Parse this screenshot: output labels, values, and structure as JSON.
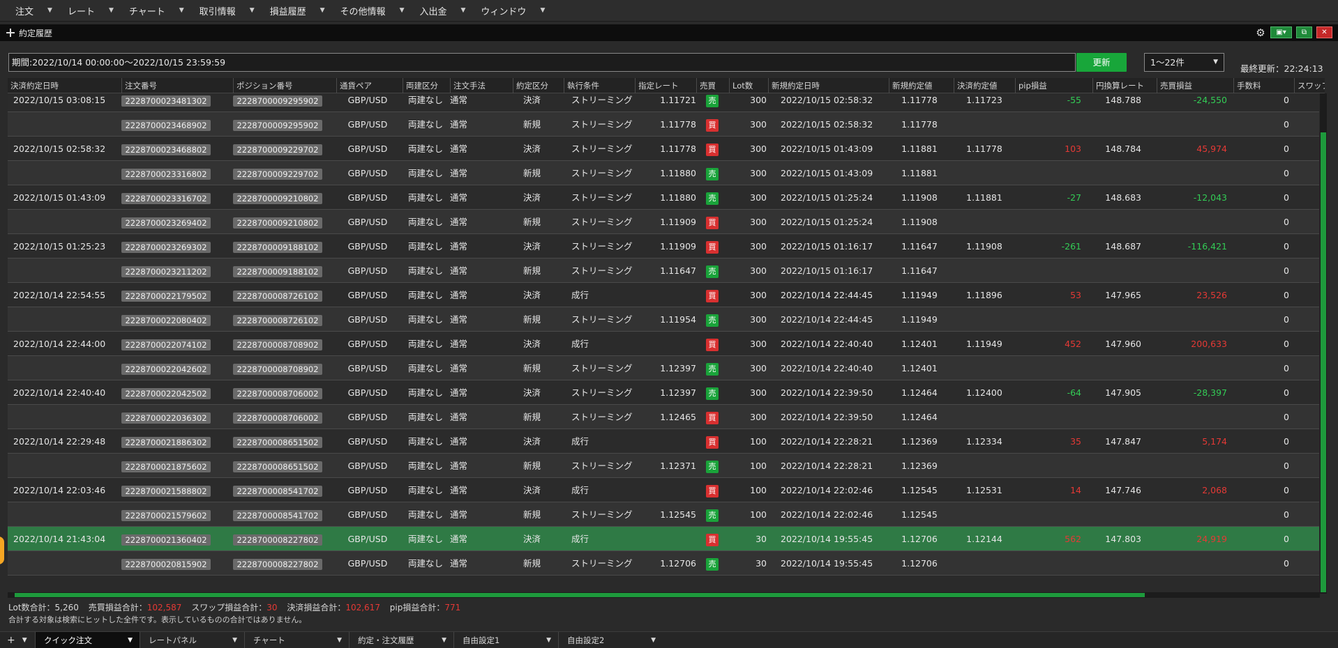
{
  "menu": [
    {
      "label": "注文"
    },
    {
      "label": "レート"
    },
    {
      "label": "チャート"
    },
    {
      "label": "取引情報"
    },
    {
      "label": "損益履歴"
    },
    {
      "label": "その他情報"
    },
    {
      "label": "入出金"
    },
    {
      "label": "ウィンドウ"
    }
  ],
  "window": {
    "title": "約定履歴"
  },
  "filter": {
    "period": "期間:2022/10/14 00:00:00～2022/10/15 23:59:59",
    "refresh_label": "更新",
    "page_range": "1～22件",
    "last_update": "最終更新：22:24:13"
  },
  "columns": [
    "決済約定日時",
    "注文番号",
    "ポジション番号",
    "通貨ペア",
    "両建区分",
    "注文手法",
    "約定区分",
    "執行条件",
    "指定レート",
    "売買",
    "Lot数",
    "新規約定日時",
    "新規約定値",
    "決済約定値",
    "pip損益",
    "円換算レート",
    "売買損益",
    "手数料",
    "スワップ損"
  ],
  "rows": [
    {
      "settle_time": "2022/10/15 03:08:15",
      "order_no": "2228700023481302",
      "pos_no": "2228700009295902",
      "pair": "GBP/USD",
      "hedge": "両建なし",
      "method": "通常",
      "kind": "決済",
      "cond": "ストリーミング",
      "rate": "1.11721",
      "side": "売",
      "lot": "300",
      "open_time": "2022/10/15 02:58:32",
      "open_price": "1.11778",
      "close_price": "1.11723",
      "pip": "-55",
      "jpy_rate": "148.788",
      "pl": "-24,550",
      "fee": "0"
    },
    {
      "settle_time": "",
      "order_no": "2228700023468902",
      "pos_no": "2228700009295902",
      "pair": "GBP/USD",
      "hedge": "両建なし",
      "method": "通常",
      "kind": "新規",
      "cond": "ストリーミング",
      "rate": "1.11778",
      "side": "買",
      "lot": "300",
      "open_time": "2022/10/15 02:58:32",
      "open_price": "1.11778",
      "close_price": "",
      "pip": "",
      "jpy_rate": "",
      "pl": "",
      "fee": "0"
    },
    {
      "settle_time": "2022/10/15 02:58:32",
      "order_no": "2228700023468802",
      "pos_no": "2228700009229702",
      "pair": "GBP/USD",
      "hedge": "両建なし",
      "method": "通常",
      "kind": "決済",
      "cond": "ストリーミング",
      "rate": "1.11778",
      "side": "買",
      "lot": "300",
      "open_time": "2022/10/15 01:43:09",
      "open_price": "1.11881",
      "close_price": "1.11778",
      "pip": "103",
      "jpy_rate": "148.784",
      "pl": "45,974",
      "fee": "0"
    },
    {
      "settle_time": "",
      "order_no": "2228700023316802",
      "pos_no": "2228700009229702",
      "pair": "GBP/USD",
      "hedge": "両建なし",
      "method": "通常",
      "kind": "新規",
      "cond": "ストリーミング",
      "rate": "1.11880",
      "side": "売",
      "lot": "300",
      "open_time": "2022/10/15 01:43:09",
      "open_price": "1.11881",
      "close_price": "",
      "pip": "",
      "jpy_rate": "",
      "pl": "",
      "fee": "0"
    },
    {
      "settle_time": "2022/10/15 01:43:09",
      "order_no": "2228700023316702",
      "pos_no": "2228700009210802",
      "pair": "GBP/USD",
      "hedge": "両建なし",
      "method": "通常",
      "kind": "決済",
      "cond": "ストリーミング",
      "rate": "1.11880",
      "side": "売",
      "lot": "300",
      "open_time": "2022/10/15 01:25:24",
      "open_price": "1.11908",
      "close_price": "1.11881",
      "pip": "-27",
      "jpy_rate": "148.683",
      "pl": "-12,043",
      "fee": "0"
    },
    {
      "settle_time": "",
      "order_no": "2228700023269402",
      "pos_no": "2228700009210802",
      "pair": "GBP/USD",
      "hedge": "両建なし",
      "method": "通常",
      "kind": "新規",
      "cond": "ストリーミング",
      "rate": "1.11909",
      "side": "買",
      "lot": "300",
      "open_time": "2022/10/15 01:25:24",
      "open_price": "1.11908",
      "close_price": "",
      "pip": "",
      "jpy_rate": "",
      "pl": "",
      "fee": "0"
    },
    {
      "settle_time": "2022/10/15 01:25:23",
      "order_no": "2228700023269302",
      "pos_no": "2228700009188102",
      "pair": "GBP/USD",
      "hedge": "両建なし",
      "method": "通常",
      "kind": "決済",
      "cond": "ストリーミング",
      "rate": "1.11909",
      "side": "買",
      "lot": "300",
      "open_time": "2022/10/15 01:16:17",
      "open_price": "1.11647",
      "close_price": "1.11908",
      "pip": "-261",
      "jpy_rate": "148.687",
      "pl": "-116,421",
      "fee": "0"
    },
    {
      "settle_time": "",
      "order_no": "2228700023211202",
      "pos_no": "2228700009188102",
      "pair": "GBP/USD",
      "hedge": "両建なし",
      "method": "通常",
      "kind": "新規",
      "cond": "ストリーミング",
      "rate": "1.11647",
      "side": "売",
      "lot": "300",
      "open_time": "2022/10/15 01:16:17",
      "open_price": "1.11647",
      "close_price": "",
      "pip": "",
      "jpy_rate": "",
      "pl": "",
      "fee": "0"
    },
    {
      "settle_time": "2022/10/14 22:54:55",
      "order_no": "2228700022179502",
      "pos_no": "2228700008726102",
      "pair": "GBP/USD",
      "hedge": "両建なし",
      "method": "通常",
      "kind": "決済",
      "cond": "成行",
      "rate": "",
      "side": "買",
      "lot": "300",
      "open_time": "2022/10/14 22:44:45",
      "open_price": "1.11949",
      "close_price": "1.11896",
      "pip": "53",
      "jpy_rate": "147.965",
      "pl": "23,526",
      "fee": "0"
    },
    {
      "settle_time": "",
      "order_no": "2228700022080402",
      "pos_no": "2228700008726102",
      "pair": "GBP/USD",
      "hedge": "両建なし",
      "method": "通常",
      "kind": "新規",
      "cond": "ストリーミング",
      "rate": "1.11954",
      "side": "売",
      "lot": "300",
      "open_time": "2022/10/14 22:44:45",
      "open_price": "1.11949",
      "close_price": "",
      "pip": "",
      "jpy_rate": "",
      "pl": "",
      "fee": "0"
    },
    {
      "settle_time": "2022/10/14 22:44:00",
      "order_no": "2228700022074102",
      "pos_no": "2228700008708902",
      "pair": "GBP/USD",
      "hedge": "両建なし",
      "method": "通常",
      "kind": "決済",
      "cond": "成行",
      "rate": "",
      "side": "買",
      "lot": "300",
      "open_time": "2022/10/14 22:40:40",
      "open_price": "1.12401",
      "close_price": "1.11949",
      "pip": "452",
      "jpy_rate": "147.960",
      "pl": "200,633",
      "fee": "0"
    },
    {
      "settle_time": "",
      "order_no": "2228700022042602",
      "pos_no": "2228700008708902",
      "pair": "GBP/USD",
      "hedge": "両建なし",
      "method": "通常",
      "kind": "新規",
      "cond": "ストリーミング",
      "rate": "1.12397",
      "side": "売",
      "lot": "300",
      "open_time": "2022/10/14 22:40:40",
      "open_price": "1.12401",
      "close_price": "",
      "pip": "",
      "jpy_rate": "",
      "pl": "",
      "fee": "0"
    },
    {
      "settle_time": "2022/10/14 22:40:40",
      "order_no": "2228700022042502",
      "pos_no": "2228700008706002",
      "pair": "GBP/USD",
      "hedge": "両建なし",
      "method": "通常",
      "kind": "決済",
      "cond": "ストリーミング",
      "rate": "1.12397",
      "side": "売",
      "lot": "300",
      "open_time": "2022/10/14 22:39:50",
      "open_price": "1.12464",
      "close_price": "1.12400",
      "pip": "-64",
      "jpy_rate": "147.905",
      "pl": "-28,397",
      "fee": "0"
    },
    {
      "settle_time": "",
      "order_no": "2228700022036302",
      "pos_no": "2228700008706002",
      "pair": "GBP/USD",
      "hedge": "両建なし",
      "method": "通常",
      "kind": "新規",
      "cond": "ストリーミング",
      "rate": "1.12465",
      "side": "買",
      "lot": "300",
      "open_time": "2022/10/14 22:39:50",
      "open_price": "1.12464",
      "close_price": "",
      "pip": "",
      "jpy_rate": "",
      "pl": "",
      "fee": "0"
    },
    {
      "settle_time": "2022/10/14 22:29:48",
      "order_no": "2228700021886302",
      "pos_no": "2228700008651502",
      "pair": "GBP/USD",
      "hedge": "両建なし",
      "method": "通常",
      "kind": "決済",
      "cond": "成行",
      "rate": "",
      "side": "買",
      "lot": "100",
      "open_time": "2022/10/14 22:28:21",
      "open_price": "1.12369",
      "close_price": "1.12334",
      "pip": "35",
      "jpy_rate": "147.847",
      "pl": "5,174",
      "fee": "0"
    },
    {
      "settle_time": "",
      "order_no": "2228700021875602",
      "pos_no": "2228700008651502",
      "pair": "GBP/USD",
      "hedge": "両建なし",
      "method": "通常",
      "kind": "新規",
      "cond": "ストリーミング",
      "rate": "1.12371",
      "side": "売",
      "lot": "100",
      "open_time": "2022/10/14 22:28:21",
      "open_price": "1.12369",
      "close_price": "",
      "pip": "",
      "jpy_rate": "",
      "pl": "",
      "fee": "0"
    },
    {
      "settle_time": "2022/10/14 22:03:46",
      "order_no": "2228700021588802",
      "pos_no": "2228700008541702",
      "pair": "GBP/USD",
      "hedge": "両建なし",
      "method": "通常",
      "kind": "決済",
      "cond": "成行",
      "rate": "",
      "side": "買",
      "lot": "100",
      "open_time": "2022/10/14 22:02:46",
      "open_price": "1.12545",
      "close_price": "1.12531",
      "pip": "14",
      "jpy_rate": "147.746",
      "pl": "2,068",
      "fee": "0"
    },
    {
      "settle_time": "",
      "order_no": "2228700021579602",
      "pos_no": "2228700008541702",
      "pair": "GBP/USD",
      "hedge": "両建なし",
      "method": "通常",
      "kind": "新規",
      "cond": "ストリーミング",
      "rate": "1.12545",
      "side": "売",
      "lot": "100",
      "open_time": "2022/10/14 22:02:46",
      "open_price": "1.12545",
      "close_price": "",
      "pip": "",
      "jpy_rate": "",
      "pl": "",
      "fee": "0"
    },
    {
      "settle_time": "2022/10/14 21:43:04",
      "order_no": "2228700021360402",
      "pos_no": "2228700008227802",
      "pair": "GBP/USD",
      "hedge": "両建なし",
      "method": "通常",
      "kind": "決済",
      "cond": "成行",
      "rate": "",
      "side": "買",
      "lot": "30",
      "open_time": "2022/10/14 19:55:45",
      "open_price": "1.12706",
      "close_price": "1.12144",
      "pip": "562",
      "jpy_rate": "147.803",
      "pl": "24,919",
      "fee": "0",
      "highlight": true
    },
    {
      "settle_time": "",
      "order_no": "2228700020815902",
      "pos_no": "2228700008227802",
      "pair": "GBP/USD",
      "hedge": "両建なし",
      "method": "通常",
      "kind": "新規",
      "cond": "ストリーミング",
      "rate": "1.12706",
      "side": "売",
      "lot": "30",
      "open_time": "2022/10/14 19:55:45",
      "open_price": "1.12706",
      "close_price": "",
      "pip": "",
      "jpy_rate": "",
      "pl": "",
      "fee": "0"
    }
  ],
  "totals": {
    "lot_label": "Lot数合計：",
    "lot_value": "5,260",
    "pl_label": "売買損益合計：",
    "pl_value": "102,587",
    "swap_label": "スワップ損益合計：",
    "swap_value": "30",
    "settle_label": "決済損益合計：",
    "settle_value": "102,617",
    "pip_label": "pip損益合計：",
    "pip_value": "771",
    "note": "合計する対象は検索にヒットした全件です。表示しているものの合計ではありません。"
  },
  "tabs": [
    {
      "label": "クイック注文",
      "active": true
    },
    {
      "label": "レートパネル"
    },
    {
      "label": "チャート"
    },
    {
      "label": "約定・注文履歴"
    },
    {
      "label": "自由設定1"
    },
    {
      "label": "自由設定2"
    }
  ],
  "colors": {
    "accent_green": "#18a63a",
    "buy_red": "#d83030",
    "sell_green": "#1aa33a",
    "loss_green": "#33cc55",
    "profit_red": "#e53935",
    "highlight_row": "#2f7a45"
  },
  "icons": {
    "move": "move-icon",
    "gear": "gear-icon",
    "close": "close-icon",
    "chevron": "chevron-down-icon"
  }
}
